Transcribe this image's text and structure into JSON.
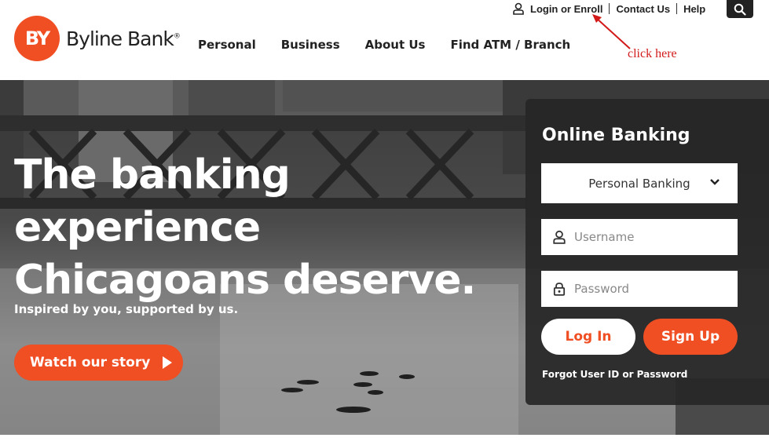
{
  "header": {
    "logo_mark": "BY",
    "logo_text": "Byline Bank",
    "logo_reg": "®",
    "nav": [
      "Personal",
      "Business",
      "About Us",
      "Find ATM / Branch"
    ],
    "utility": {
      "login": "Login or Enroll",
      "contact": "Contact Us",
      "help": "Help"
    },
    "search_icon": "search-icon",
    "annotation": "click here"
  },
  "hero": {
    "headline": [
      "The banking",
      "experience",
      "Chicagoans deserve."
    ],
    "subline": "Inspired by you, supported by us.",
    "cta": "Watch our story"
  },
  "login_panel": {
    "title": "Online Banking",
    "account_type": "Personal Banking",
    "username_placeholder": "Username",
    "password_placeholder": "Password",
    "login_button": "Log In",
    "signup_button": "Sign Up",
    "forgot": "Forgot User ID or Password"
  },
  "colors": {
    "brand_orange": "#f04e23",
    "panel_dark": "#262626",
    "annotation_red": "#d21a1a"
  }
}
